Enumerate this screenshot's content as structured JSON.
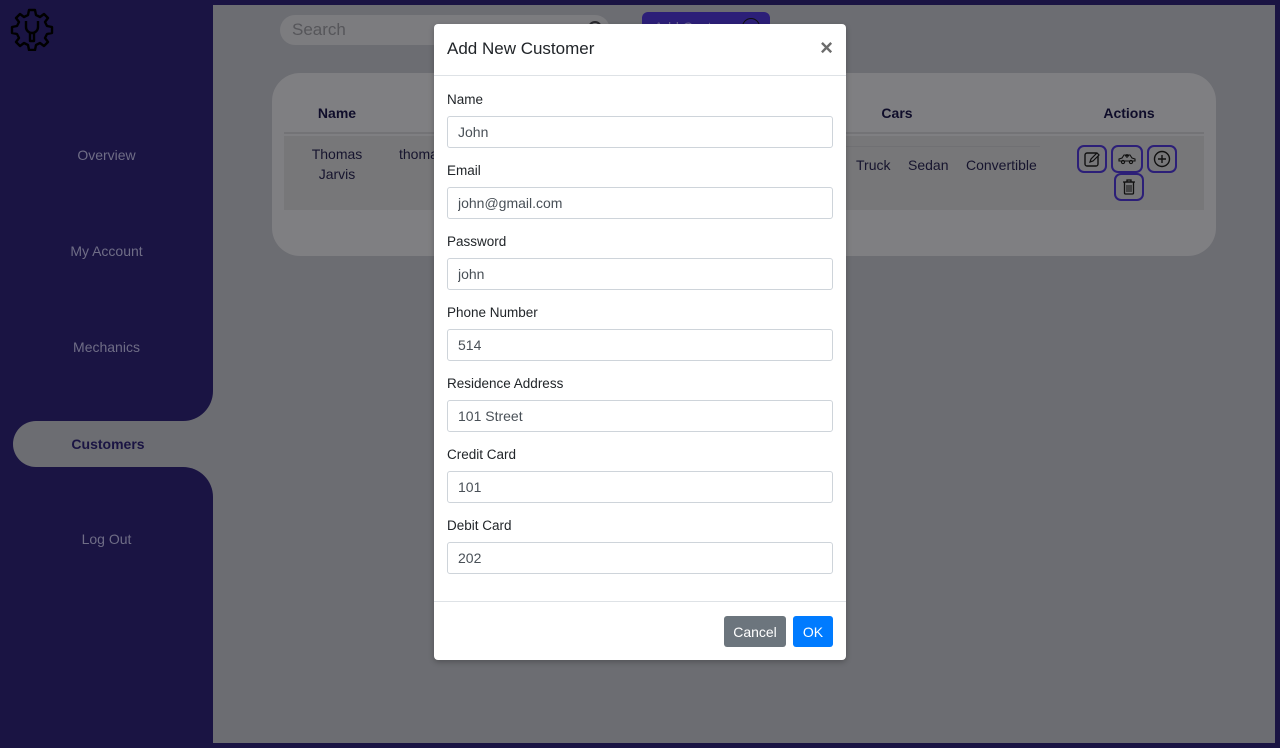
{
  "sidebar": {
    "logo_icon": "gear-wrench-icon",
    "items": [
      {
        "label": "Overview",
        "active": false
      },
      {
        "label": "My Account",
        "active": false
      },
      {
        "label": "Mechanics",
        "active": false
      },
      {
        "label": "Customers",
        "active": true
      },
      {
        "label": "Log Out",
        "active": false
      }
    ]
  },
  "toolbar": {
    "search_placeholder": "Search",
    "add_button_label": "Add Customer"
  },
  "table": {
    "headers": [
      "Name",
      "Cars",
      "Actions"
    ],
    "rows": [
      {
        "name": "Thomas Jarvis",
        "email_partial": "thoma",
        "cars": [
          "Truck",
          "Sedan",
          "Convertible"
        ],
        "actions": [
          "edit-icon",
          "add-car-icon",
          "add-circle-icon",
          "trash-icon"
        ]
      }
    ]
  },
  "modal": {
    "title": "Add New Customer",
    "close_label": "×",
    "fields": [
      {
        "label": "Name",
        "value": "John"
      },
      {
        "label": "Email",
        "value": "john@gmail.com"
      },
      {
        "label": "Password",
        "value": "john"
      },
      {
        "label": "Phone Number",
        "value": "514"
      },
      {
        "label": "Residence Address",
        "value": "101 Street"
      },
      {
        "label": "Credit Card",
        "value": "101"
      },
      {
        "label": "Debit Card",
        "value": "202"
      }
    ],
    "cancel_label": "Cancel",
    "ok_label": "OK"
  },
  "colors": {
    "sidebar_bg": "#1a1443",
    "accent_purple": "#2c1f78",
    "overlay_bg": "#6c6d72",
    "ok_blue": "#007bff",
    "cancel_gray": "#6c757d"
  }
}
